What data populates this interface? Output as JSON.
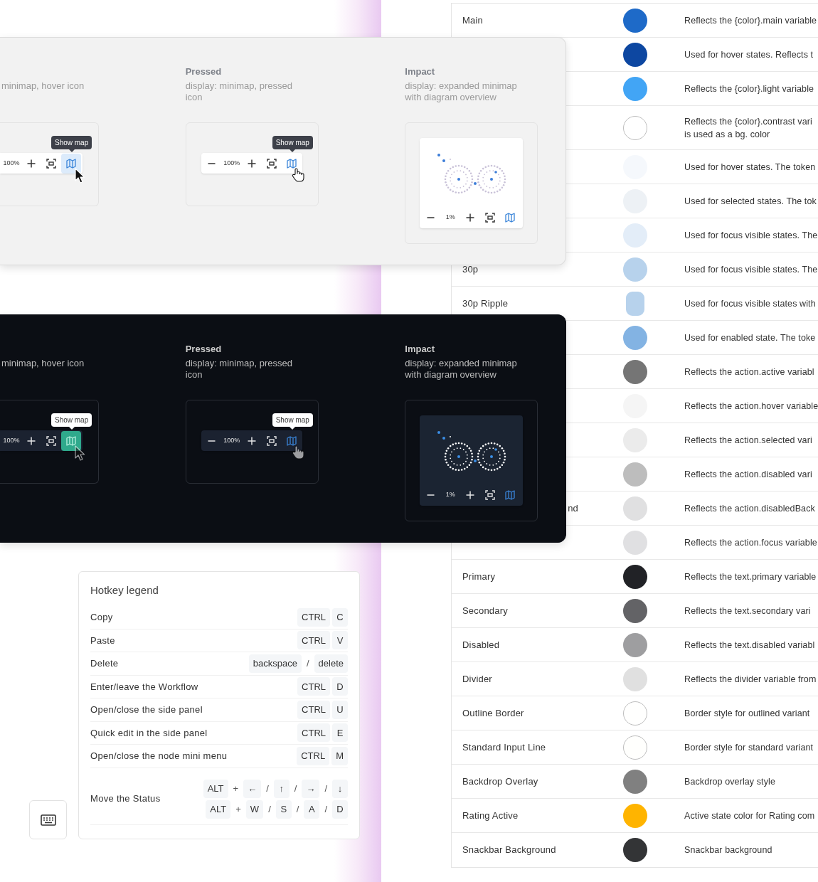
{
  "light_panel": {
    "dark": false,
    "columns": [
      {
        "cut": true,
        "description": "minimap, hover icon",
        "card": {
          "kind": "toolbar",
          "zoom": "100%",
          "tooltip": "Show map",
          "hovered": true
        }
      },
      {
        "cut": false,
        "title": "Pressed",
        "description": "display: minimap, pressed icon",
        "card": {
          "kind": "toolbar",
          "zoom": "100%",
          "tooltip": "Show map",
          "hovered": false
        }
      },
      {
        "title": "Impact",
        "description": "display: expanded minimap with diagram overview",
        "card": {
          "kind": "minimap",
          "zoom": "1%"
        }
      }
    ]
  },
  "dark_panel": {
    "dark": true,
    "columns": [
      {
        "cut": true,
        "description": "minimap, hover icon",
        "card": {
          "kind": "toolbar",
          "zoom": "100%",
          "tooltip": "Show map",
          "hovered": true
        }
      },
      {
        "cut": false,
        "title": "Pressed",
        "description": "display: minimap, pressed icon",
        "card": {
          "kind": "toolbar",
          "zoom": "100%",
          "tooltip": "Show map",
          "hovered": false
        }
      },
      {
        "title": "Impact",
        "description": "display: expanded minimap with diagram overview",
        "card": {
          "kind": "minimap",
          "zoom": "1%"
        }
      }
    ]
  },
  "hotkey_legend": {
    "title": "Hotkey legend",
    "rows": [
      {
        "action": "Copy",
        "key_lines": [
          [
            {
              "kind": "key",
              "text": "CTRL"
            },
            {
              "kind": "key",
              "text": "C"
            }
          ]
        ]
      },
      {
        "action": "Paste",
        "key_lines": [
          [
            {
              "kind": "key",
              "text": "CTRL"
            },
            {
              "kind": "key",
              "text": "V"
            }
          ]
        ]
      },
      {
        "action": "Delete",
        "key_lines": [
          [
            {
              "kind": "key",
              "text": "backspace"
            },
            {
              "kind": "sep",
              "text": "/"
            },
            {
              "kind": "key",
              "text": "delete"
            }
          ]
        ]
      },
      {
        "action": "Enter/leave the Workflow",
        "key_lines": [
          [
            {
              "kind": "key",
              "text": "CTRL"
            },
            {
              "kind": "key",
              "text": "D"
            }
          ]
        ]
      },
      {
        "action": "Open/close the side panel",
        "key_lines": [
          [
            {
              "kind": "key",
              "text": "CTRL"
            },
            {
              "kind": "key",
              "text": "U"
            }
          ]
        ]
      },
      {
        "action": "Quick edit in the side panel",
        "key_lines": [
          [
            {
              "kind": "key",
              "text": "CTRL"
            },
            {
              "kind": "key",
              "text": "E"
            }
          ]
        ]
      },
      {
        "action": "Open/close the node mini menu",
        "key_lines": [
          [
            {
              "kind": "key",
              "text": "CTRL"
            },
            {
              "kind": "key",
              "text": "M"
            }
          ]
        ]
      },
      {
        "action": "Move the Status",
        "key_lines": [
          [
            {
              "kind": "key",
              "text": "ALT"
            },
            {
              "kind": "sep",
              "text": "+"
            },
            {
              "kind": "key",
              "text": "←"
            },
            {
              "kind": "sep",
              "text": "/"
            },
            {
              "kind": "key",
              "text": "↑"
            },
            {
              "kind": "sep",
              "text": "/"
            },
            {
              "kind": "key",
              "text": "→"
            },
            {
              "kind": "sep",
              "text": "/"
            },
            {
              "kind": "key",
              "text": "↓"
            }
          ],
          [
            {
              "kind": "key",
              "text": "ALT"
            },
            {
              "kind": "sep",
              "text": "+"
            },
            {
              "kind": "key",
              "text": "W"
            },
            {
              "kind": "sep",
              "text": "/"
            },
            {
              "kind": "key",
              "text": "S"
            },
            {
              "kind": "sep",
              "text": "/"
            },
            {
              "kind": "key",
              "text": "A"
            },
            {
              "kind": "sep",
              "text": "/"
            },
            {
              "kind": "key",
              "text": "D"
            }
          ]
        ]
      }
    ]
  },
  "color_tokens": {
    "rows": [
      {
        "name": "Main",
        "kind": "dot",
        "color": "#1e6ac8",
        "description": "Reflects the {color}.main variable"
      },
      {
        "kind": "dot",
        "color": "#0d47a1",
        "description": "Used for hover states. Reflects t"
      },
      {
        "kind": "dot",
        "color": "#42a5f5",
        "description": "Reflects the {color}.light variable"
      },
      {
        "kind": "outlined",
        "color": "#ffffff",
        "description": "Reflects the {color}.contrast vari\nis used as a bg. color"
      },
      {
        "kind": "dot",
        "color": "#f5f8fc",
        "description": "Used for hover states. The token"
      },
      {
        "kind": "dot",
        "color": "#edf1f5",
        "description": "Used for selected states. The tok"
      },
      {
        "kind": "dot",
        "color": "#e3edf8",
        "description": "Used for focus visible states. The"
      },
      {
        "name": "30p",
        "kind": "dot",
        "color": "#b7d2ec",
        "description": "Used for focus visible states. The"
      },
      {
        "name": "30p Ripple",
        "kind": "ripple",
        "color": "#b7d2ec",
        "description": "Used for focus visible states with"
      },
      {
        "kind": "dot",
        "color": "#83b3e3",
        "description": "Used for enabled state. The toke"
      },
      {
        "kind": "dot",
        "color": "#757575",
        "description": "Reflects the action.active variabl"
      },
      {
        "kind": "dot",
        "color": "#f5f5f5",
        "description": "Reflects the action.hover variable"
      },
      {
        "kind": "dot",
        "color": "#ebebeb",
        "description": "Reflects the action.selected vari"
      },
      {
        "kind": "dot",
        "color": "#bdbdbd",
        "description": "Reflects the action.disabled vari"
      },
      {
        "name": "nd",
        "name_cut": true,
        "kind": "dot",
        "color": "#e0e0e1",
        "description": "Reflects the action.disabledBack"
      },
      {
        "kind": "dot",
        "color": "#e0e0e2",
        "description": "Reflects the action.focus variable"
      },
      {
        "name": "Primary",
        "kind": "dot",
        "color": "#212226",
        "description": "Reflects the text.primary variable"
      },
      {
        "name": "Secondary",
        "kind": "dot",
        "color": "#636366",
        "description": "Reflects the text.secondary vari"
      },
      {
        "name": "Disabled",
        "kind": "dot",
        "color": "#9e9ea0",
        "description": "Reflects the text.disabled variabl"
      },
      {
        "name": "Divider",
        "kind": "dot",
        "color": "#e0e0e0",
        "description": "Reflects the divider variable from"
      },
      {
        "name": "Outline Border",
        "kind": "outlined",
        "color": "#fffffe",
        "description": "Border style for outlined variant"
      },
      {
        "name": "Standard Input Line",
        "kind": "outlined",
        "color": "#fffffd",
        "description": "Border style for standard variant"
      },
      {
        "name": "Backdrop Overlay",
        "kind": "dot",
        "color": "#808080",
        "description": "Backdrop overlay style"
      },
      {
        "name": "Rating Active",
        "kind": "dot",
        "color": "#ffb400",
        "description": "Active state color for Rating com"
      },
      {
        "name": "Snackbar Background",
        "kind": "dot",
        "color": "#333436",
        "description": "Snackbar background"
      }
    ]
  }
}
